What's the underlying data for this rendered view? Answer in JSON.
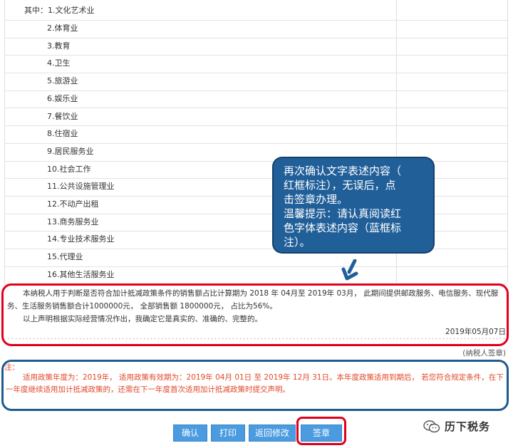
{
  "industry_list": {
    "items": [
      "其中：1.文化艺术业",
      "2.体育业",
      "3.教育",
      "4.卫生",
      "5.旅游业",
      "6.娱乐业",
      "7.餐饮业",
      "8.住宿业",
      "9.居民服务业",
      "10.社会工作",
      "11.公共设施管理业",
      "12.不动产出租",
      "13.商务服务业",
      "14.专业技术服务业",
      "15.代理业",
      "16.其他生活服务业"
    ]
  },
  "declaration": {
    "paragraph1": "本纳税人用于判断是否符合加计抵减政策条件的销售额占比计算期为 2018 年 04月至 2019年 03月， 此期间提供邮政服务、电信服务、现代服务、生活服务销售额合计1000000元， 全部销售额 1800000元， 占比为56%。",
    "paragraph2": "以上声明根据实际经营情况作出，我确定它是真实的、准确的、完整的。",
    "date": "2019年05月07日",
    "signature_label": "(纳税人签章)"
  },
  "notice": {
    "label": "注：",
    "text": "适用政策年度为：2019年， 适用政策有效期为：2019年 04月 01日 至 2019年 12月 31日。本年度政策适用到期后， 若您符合规定条件，在下一年度继续适用加计抵减政策的，还需在下一年度首次适用加计抵减政策时提交声明。"
  },
  "buttons": {
    "confirm": "确认",
    "print": "打印",
    "back_edit": "返回修改",
    "sign": "签章"
  },
  "callout": {
    "line1": "再次确认文字表述内容（",
    "line2": "红框标注），无误后，点",
    "line3": "击签章办理。",
    "line4": "温馨提示：请认真阅读红",
    "line5": "色字体表述内容（蓝框标",
    "line6": "注）。"
  },
  "watermark": {
    "text": "历下税务",
    "icon": "wechat-icon"
  },
  "colors": {
    "button_blue": "#4a9be0",
    "highlight_red": "#e0001b",
    "highlight_blue": "#1f5b8e",
    "notice_text": "#e0492a",
    "callout_bg": "#215f99"
  }
}
